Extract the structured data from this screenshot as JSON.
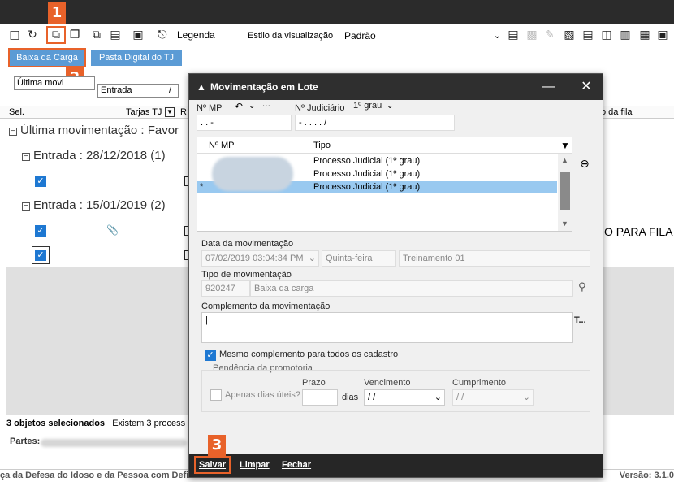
{
  "toolbar": {
    "legend_label": "Legenda",
    "style_label": "Estilo da visualização",
    "style_value": "Padrão"
  },
  "actions": {
    "baixa_carga": "Baixa da Carga",
    "pasta_digital": "Pasta Digital do TJ"
  },
  "callouts": [
    "1",
    "2",
    "3"
  ],
  "filter": {
    "view_value": "Última movi",
    "entry_value": "Entrada",
    "entry_slash": "/"
  },
  "columns": {
    "sel": "Sel.",
    "tarjas": "Tarjas TJ",
    "r": "R",
    "fila": "o da fila"
  },
  "groups": {
    "top": "Última movimentação : Favor",
    "entry1": "Entrada : 28/12/2018  (1)",
    "entry2": "Entrada : 15/01/2019  (2)"
  },
  "background_row_text": "O PARA FILA",
  "status": {
    "selected": "3 objetos selecionados",
    "exist": "Existem 3 process"
  },
  "partes_label": "Partes:",
  "footer": {
    "left": "ça da Defesa do Idoso e da Pessoa com Defi",
    "right": "Versão: 3.1.0"
  },
  "modal": {
    "title": "Movimentação em Lote",
    "nmp_label": "Nº MP",
    "njud_label": "Nº Judiciário",
    "grau_value": "1º grau",
    "nmp_value": ".  .        -",
    "njud_value": "-  .  .  .  .  /",
    "list": {
      "col_nmp": "Nº MP",
      "col_tipo": "Tipo",
      "rows": [
        {
          "tipo": "Processo Judicial (1º grau)",
          "marker": ""
        },
        {
          "tipo": "Processo Judicial (1º grau)",
          "marker": ""
        },
        {
          "tipo": "Processo Judicial (1º grau)",
          "marker": "*"
        }
      ]
    },
    "data_mov_label": "Data da movimentação",
    "data_mov_value": "07/02/2019 03:04:34 PM",
    "weekday": "Quinta-feira",
    "treinamento": "Treinamento 01",
    "tipo_mov_label": "Tipo de movimentação",
    "tipo_code": "920247",
    "tipo_desc": "Baixa da carga",
    "complemento_label": "Complemento da movimentação",
    "complemento_value": "|",
    "t_button": "T...",
    "mesmo_label": "Mesmo complemento para todos os cadastro",
    "pendencia_label": "Pendência da promotoria",
    "apenas_label": "Apenas dias úteis?",
    "prazo_label": "Prazo",
    "dias_label": "dias",
    "vencimento_label": "Vencimento",
    "vencimento_value": "/  /",
    "cumprimento_label": "Cumprimento",
    "cumprimento_value": "/  /",
    "btn_salvar": "Salvar",
    "btn_limpar": "Limpar",
    "btn_fechar": "Fechar"
  }
}
